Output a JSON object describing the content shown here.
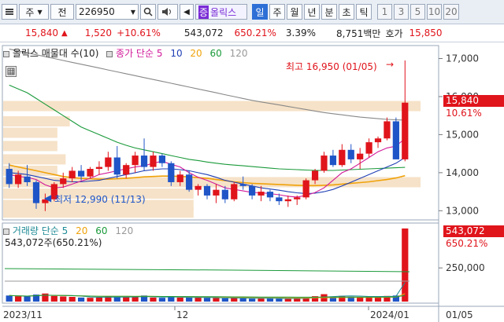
{
  "toolbar": {
    "market": "주",
    "sub": "전",
    "code": "226950",
    "name_badge": "증",
    "name": "올릭스",
    "periods": [
      "일",
      "주",
      "월",
      "년",
      "분",
      "초",
      "틱"
    ],
    "active_period": "일",
    "numbers": [
      "1",
      "3",
      "5",
      "10",
      "20"
    ]
  },
  "pricebar": {
    "price": "15,840",
    "change": "1,520",
    "change_pct": "+10.61%",
    "volume": "543,072",
    "volume_ratio": "650.21%",
    "turnover": "3.39%",
    "amount": "8,751백만",
    "ask_label": "호가",
    "ask": "15,850"
  },
  "price_chart": {
    "title": "올릭스 매물대 수(10)",
    "ma_label": "종가 단순",
    "ma_periods": [
      "5",
      "10",
      "20",
      "60",
      "120"
    ],
    "high_annotation": "최고 16,950 (01/05)",
    "low_annotation": "최저 12,990 (11/13)",
    "y_ticks": [
      "17,000",
      "16,000",
      "15,000",
      "14,000",
      "13,000"
    ],
    "last_price": "15,840",
    "last_pct": "10.61%"
  },
  "volume_chart": {
    "label": "거래량 단순",
    "ma_periods": [
      "5",
      "20",
      "60",
      "120"
    ],
    "value_text": "543,072주(650.21%)",
    "y_tick": "250,000",
    "last_volume": "543,072",
    "last_pct": "650.21%"
  },
  "x_axis": {
    "labels": [
      "2023/11",
      "12",
      "2024/01",
      "01/05"
    ]
  },
  "colors": {
    "up": "#e0141b",
    "down": "#1f55c7",
    "ma5": "#d11a9a",
    "ma10": "#1f3fb5",
    "ma20": "#f0a20a",
    "ma60": "#1a9a3a",
    "ma120": "#888888",
    "volume_profile": "#f6e2c8"
  },
  "chart_data": {
    "type": "candlestick",
    "title": "올릭스",
    "y_range": [
      12800,
      17300
    ],
    "candles": [
      [
        14100,
        14250,
        13600,
        13700
      ],
      [
        13700,
        14050,
        13600,
        13950
      ],
      [
        13900,
        14200,
        13650,
        13750
      ],
      [
        13750,
        13800,
        13050,
        13200
      ],
      [
        13200,
        13450,
        12990,
        13300
      ],
      [
        13300,
        13750,
        13250,
        13700
      ],
      [
        13700,
        14000,
        13600,
        13850
      ],
      [
        13850,
        14150,
        13750,
        14050
      ],
      [
        14050,
        14200,
        13800,
        13900
      ],
      [
        13900,
        14150,
        13850,
        14100
      ],
      [
        14100,
        14300,
        13950,
        14150
      ],
      [
        14150,
        14550,
        14050,
        14400
      ],
      [
        14400,
        14700,
        13850,
        13950
      ],
      [
        13950,
        14250,
        13850,
        14200
      ],
      [
        14200,
        14550,
        14000,
        14450
      ],
      [
        14450,
        14900,
        14050,
        14150
      ],
      [
        14150,
        14550,
        14050,
        14450
      ],
      [
        14450,
        14500,
        14150,
        14250
      ],
      [
        14250,
        14300,
        13650,
        13750
      ],
      [
        13750,
        14050,
        13650,
        13950
      ],
      [
        13950,
        14050,
        13500,
        13550
      ],
      [
        13550,
        13700,
        13400,
        13650
      ],
      [
        13650,
        13700,
        13300,
        13400
      ],
      [
        13400,
        13700,
        13200,
        13550
      ],
      [
        13550,
        13650,
        13200,
        13300
      ],
      [
        13300,
        13750,
        13250,
        13700
      ],
      [
        13700,
        13900,
        13550,
        13650
      ],
      [
        13650,
        13700,
        13300,
        13400
      ],
      [
        13400,
        13650,
        13250,
        13500
      ],
      [
        13500,
        13550,
        13250,
        13350
      ],
      [
        13350,
        13450,
        13150,
        13250
      ],
      [
        13250,
        13400,
        13100,
        13300
      ],
      [
        13300,
        13400,
        13150,
        13350
      ],
      [
        13350,
        13850,
        13300,
        13800
      ],
      [
        13800,
        14100,
        13700,
        14050
      ],
      [
        14050,
        14550,
        14000,
        14450
      ],
      [
        14450,
        14600,
        14150,
        14200
      ],
      [
        14200,
        14750,
        14150,
        14600
      ],
      [
        14600,
        14750,
        14250,
        14350
      ],
      [
        14350,
        14650,
        14100,
        14500
      ],
      [
        14500,
        14900,
        14400,
        14800
      ],
      [
        14800,
        14950,
        14650,
        14900
      ],
      [
        14900,
        15450,
        14850,
        15350
      ],
      [
        15350,
        15450,
        14350,
        14350
      ],
      [
        14350,
        16950,
        14300,
        15840
      ]
    ],
    "ma5": [
      13950,
      13900,
      13880,
      13820,
      13680,
      13600,
      13620,
      13700,
      13780,
      13850,
      13950,
      14000,
      14050,
      14100,
      14150,
      14180,
      14250,
      14300,
      14220,
      14150,
      14000,
      13880,
      13800,
      13700,
      13600,
      13560,
      13520,
      13480,
      13470,
      13450,
      13420,
      13380,
      13360,
      13400,
      13480,
      13600,
      13800,
      14000,
      14100,
      14250,
      14400,
      14550,
      14650,
      14700,
      14900
    ],
    "ma10": [
      14000,
      13980,
      13950,
      13900,
      13850,
      13800,
      13780,
      13760,
      13760,
      13780,
      13800,
      13850,
      13900,
      13950,
      14000,
      14050,
      14080,
      14100,
      14100,
      14080,
      14050,
      14000,
      13950,
      13880,
      13800,
      13750,
      13700,
      13650,
      13600,
      13570,
      13540,
      13500,
      13470,
      13450,
      13460,
      13500,
      13560,
      13650,
      13750,
      13850,
      13950,
      14050,
      14150,
      14250,
      14400
    ],
    "ma20": [
      14200,
      14150,
      14100,
      14050,
      14000,
      13950,
      13900,
      13870,
      13850,
      13840,
      13830,
      13830,
      13840,
      13850,
      13870,
      13890,
      13900,
      13910,
      13910,
      13900,
      13890,
      13870,
      13850,
      13820,
      13790,
      13760,
      13740,
      13720,
      13710,
      13700,
      13690,
      13680,
      13670,
      13660,
      13660,
      13670,
      13680,
      13700,
      13720,
      13740,
      13760,
      13790,
      13820,
      13860,
      13920
    ],
    "ma60": [
      16300,
      16200,
      16100,
      15950,
      15800,
      15650,
      15500,
      15350,
      15200,
      15100,
      15000,
      14900,
      14800,
      14720,
      14650,
      14600,
      14550,
      14500,
      14450,
      14400,
      14350,
      14320,
      14280,
      14250,
      14220,
      14200,
      14180,
      14160,
      14140,
      14120,
      14100,
      14090,
      14080,
      14070,
      14060,
      14060,
      14060,
      14070,
      14080,
      14090,
      14100,
      14110,
      14120,
      14130,
      14140
    ],
    "ma120": [
      17250,
      17200,
      17150,
      17100,
      17050,
      17000,
      16950,
      16900,
      16850,
      16800,
      16750,
      16700,
      16650,
      16600,
      16550,
      16500,
      16450,
      16400,
      16350,
      16300,
      16250,
      16200,
      16150,
      16100,
      16050,
      16000,
      15950,
      15900,
      15860,
      15820,
      15780,
      15740,
      15700,
      15660,
      15620,
      15580,
      15550,
      15520,
      15490,
      15460,
      15440,
      15420,
      15400,
      15390,
      15380
    ],
    "volume_profile": [
      {
        "price": 15750,
        "weight": 1.0
      },
      {
        "price": 15350,
        "weight": 0.15
      },
      {
        "price": 15050,
        "weight": 0.12
      },
      {
        "price": 14700,
        "weight": 0.12
      },
      {
        "price": 14350,
        "weight": 0.14
      },
      {
        "price": 14050,
        "weight": 0.12
      },
      {
        "price": 13750,
        "weight": 1.0
      },
      {
        "price": 13450,
        "weight": 0.45
      },
      {
        "price": 13150,
        "weight": 0.45
      },
      {
        "price": 12950,
        "weight": 0.45
      }
    ],
    "volume": [
      45000,
      40000,
      38000,
      52000,
      60000,
      42000,
      38000,
      35000,
      30000,
      28000,
      30000,
      40000,
      36000,
      32000,
      34000,
      45000,
      30000,
      28000,
      35000,
      30000,
      32000,
      30000,
      28000,
      26000,
      25000,
      28000,
      24000,
      22000,
      26000,
      24000,
      22000,
      20000,
      24000,
      30000,
      40000,
      55000,
      38000,
      42000,
      36000,
      34000,
      40000,
      38000,
      42000,
      45000,
      543072
    ],
    "volume_y_range": [
      0,
      560000
    ]
  }
}
